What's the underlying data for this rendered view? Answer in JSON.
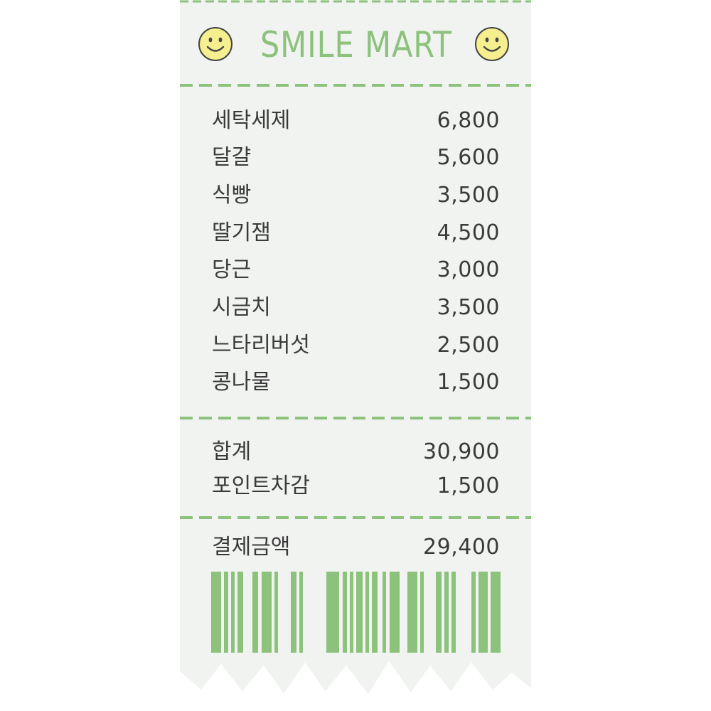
{
  "store": {
    "name": "SMILE MART",
    "smile_icon_left": "smiley-face-icon",
    "smile_icon_right": "smiley-face-icon"
  },
  "items": [
    {
      "name": "세탁세제",
      "price": "6,800"
    },
    {
      "name": "달걀",
      "price": "5,600"
    },
    {
      "name": "식빵",
      "price": "3,500"
    },
    {
      "name": "딸기잼",
      "price": "4,500"
    },
    {
      "name": "당근",
      "price": "3,000"
    },
    {
      "name": "시금치",
      "price": "3,500"
    },
    {
      "name": "느타리버섯",
      "price": "2,500"
    },
    {
      "name": "콩나물",
      "price": "1,500"
    }
  ],
  "summary": {
    "total_label": "합계",
    "total_value": "30,900",
    "points_label": "포인트차감",
    "points_value": "1,500"
  },
  "payment": {
    "label": "결제금액",
    "value": "29,400"
  },
  "colors": {
    "accent_green": "#8cc27c",
    "smiley_yellow": "#f6ef8f",
    "text_dark": "#3a3a3a",
    "paper": "#f1f3f1"
  }
}
